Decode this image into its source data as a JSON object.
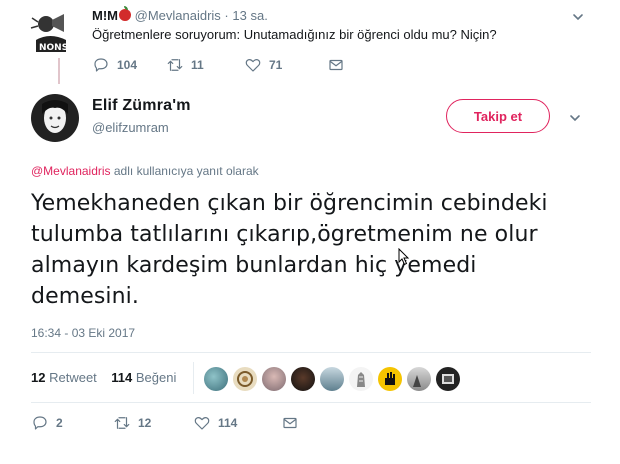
{
  "parent_tweet": {
    "name": "M!M",
    "handle": "@Mevlanaidris",
    "separator": "·",
    "time": "13 sa.",
    "text": "Öğretmenlere soruyorum: Unutamadığınız bir öğrenci oldu mu? Niçin?",
    "avatar_text": "NONS",
    "reply_count": "104",
    "retweet_count": "11",
    "like_count": "71"
  },
  "main_tweet": {
    "name": "Elif Zümra'm",
    "handle": "@elifzumram",
    "follow_label": "Takip et",
    "reply_to_mention": "@Mevlanaidris",
    "reply_to_suffix": " adlı kullanıcıya yanıt olarak",
    "text": "Yemekhaneden çıkan bir öğrencimin cebindeki tulumba tatlılarını çıkarıp,ögretmenim ne olur almayın kardeşim bunlardan hiç yemedi demesini.",
    "timestamp": "16:34 - 03 Eki 2017",
    "retweets": "12",
    "retweets_label": "Retweet",
    "likes": "114",
    "likes_label": "Beğeni",
    "reply_count": "2",
    "retweet_count": "12",
    "like_count": "114"
  },
  "likers": [
    "avatar-1",
    "avatar-2",
    "avatar-3",
    "avatar-4",
    "avatar-5",
    "avatar-6",
    "avatar-7",
    "avatar-8",
    "avatar-9"
  ],
  "colors": {
    "accent": "#e0245e",
    "muted": "#657786",
    "text": "#14171a",
    "divider": "#e6ecf0"
  },
  "icons": {
    "reply": "reply-icon",
    "retweet": "retweet-icon",
    "like": "heart-icon",
    "message": "envelope-icon",
    "menu": "chevron-down-icon"
  }
}
